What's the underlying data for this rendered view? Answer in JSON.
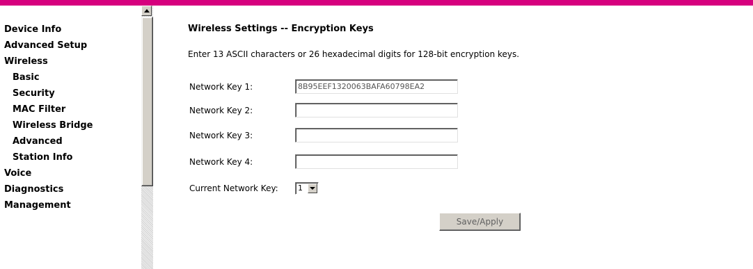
{
  "colors": {
    "accent_bar": "#d6007e"
  },
  "sidebar": {
    "items": [
      {
        "label": "Device Info"
      },
      {
        "label": "Advanced Setup"
      },
      {
        "label": "Wireless"
      },
      {
        "label": "Basic"
      },
      {
        "label": "Security"
      },
      {
        "label": "MAC Filter"
      },
      {
        "label": "Wireless Bridge"
      },
      {
        "label": "Advanced"
      },
      {
        "label": "Station Info"
      },
      {
        "label": "Voice"
      },
      {
        "label": "Diagnostics"
      },
      {
        "label": "Management"
      }
    ]
  },
  "main": {
    "title": "Wireless Settings -- Encryption Keys",
    "description": "Enter 13 ASCII characters or 26 hexadecimal digits for 128-bit encryption keys.",
    "keys": [
      {
        "label": "Network Key 1:",
        "value": "8B95EEF1320063BAFA60798EA2"
      },
      {
        "label": "Network Key 2:",
        "value": ""
      },
      {
        "label": "Network Key 3:",
        "value": ""
      },
      {
        "label": "Network Key 4:",
        "value": ""
      }
    ],
    "current_key": {
      "label": "Current Network Key:",
      "selected": "1"
    },
    "save_label": "Save/Apply"
  }
}
